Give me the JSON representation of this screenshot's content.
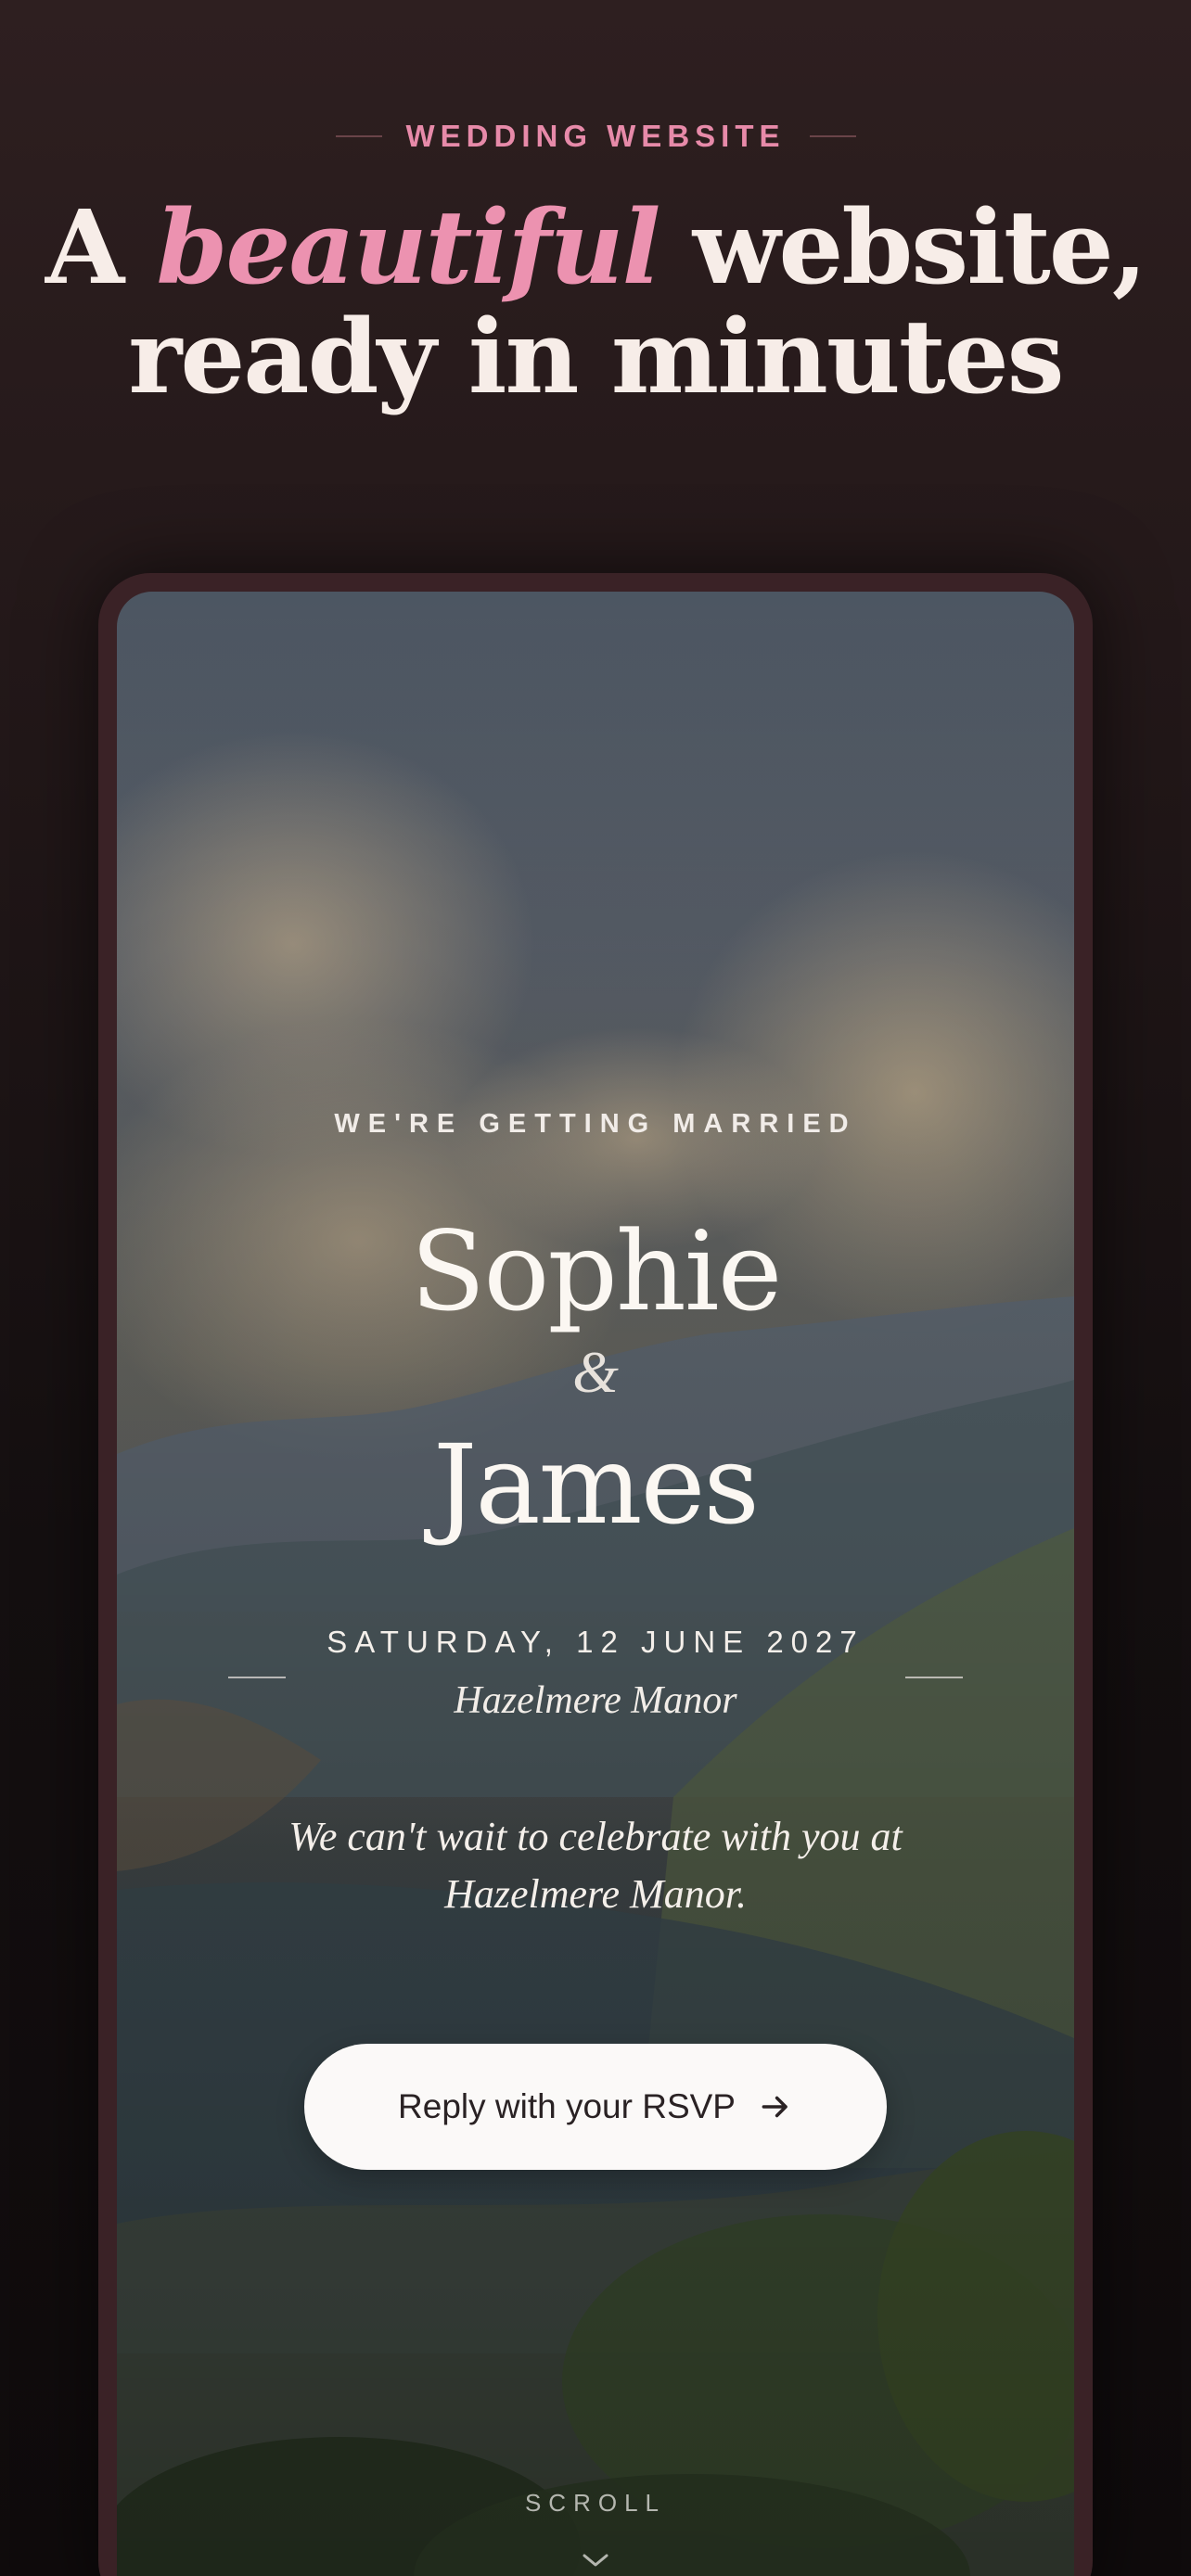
{
  "header": {
    "eyebrow": "WEDDING WEBSITE",
    "headline_prefix": "A",
    "headline_accent": "beautiful",
    "headline_suffix": "website,",
    "headline_line2": "ready in minutes"
  },
  "preview": {
    "tagline": "WE'RE GETTING MARRIED",
    "partner_one": "Sophie",
    "ampersand": "&",
    "partner_two": "James",
    "date": "SATURDAY, 12 JUNE 2027",
    "venue": "Hazelmere Manor",
    "message_line1": "We can't wait to celebrate with you at",
    "message_line2": "Hazelmere Manor.",
    "rsvp_label": "Reply with your RSVP",
    "rsvp_icon": "arrow-right-icon",
    "scroll_label": "SCROLL",
    "scroll_icon": "chevron-down-icon"
  },
  "colors": {
    "accent_pink": "#ec92b0",
    "page_background": "#1c1415",
    "phone_frame": "#3a2226",
    "button_background": "#fbf9f8"
  }
}
